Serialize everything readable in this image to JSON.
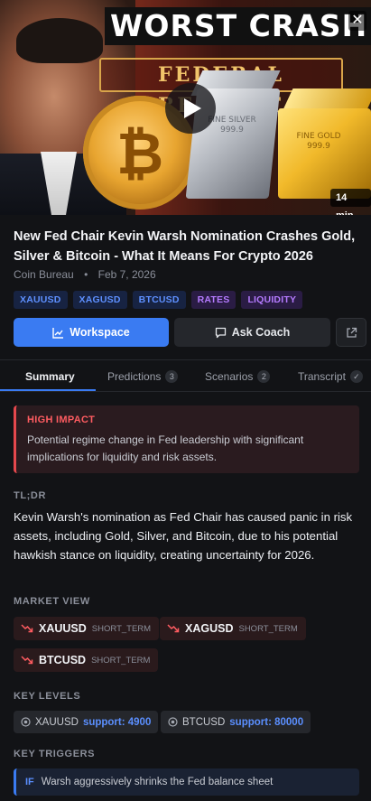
{
  "thumbnail": {
    "overlay_title": "WORST CRASH",
    "banner": "FEDERAL RESERVE",
    "silver_bar_text": "FINE SILVER 999.9",
    "gold_bar_text": "FINE GOLD 999.9",
    "duration": "14 min",
    "close_symbol": "✕"
  },
  "video": {
    "title": "New Fed Chair Kevin Warsh Nomination Crashes Gold, Silver & Bitcoin - What It Means For Crypto 2026",
    "channel": "Coin Bureau",
    "separator": "•",
    "date": "Feb 7, 2026"
  },
  "tags": [
    {
      "label": "XAUUSD",
      "color": "#5e90ff"
    },
    {
      "label": "XAGUSD",
      "color": "#5e90ff"
    },
    {
      "label": "BTCUSD",
      "color": "#5e90ff"
    },
    {
      "label": "RATES",
      "color": "#b57bff"
    },
    {
      "label": "LIQUIDITY",
      "color": "#b57bff"
    }
  ],
  "actions": {
    "workspace_label": "Workspace",
    "coach_label": "Ask Coach"
  },
  "tabs": [
    {
      "label": "Summary",
      "count": ""
    },
    {
      "label": "Predictions",
      "count": "3"
    },
    {
      "label": "Scenarios",
      "count": "2"
    },
    {
      "label": "Transcript",
      "count": "✓"
    }
  ],
  "impact": {
    "label": "HIGH IMPACT",
    "text": "Potential regime change in Fed leadership with significant implications for liquidity and risk assets."
  },
  "tldr": {
    "label": "TL;DR",
    "text": "Kevin Warsh's nomination as Fed Chair has caused panic in risk assets, including Gold, Silver, and Bitcoin, due to his potential hawkish stance on liquidity, creating uncertainty for 2026."
  },
  "market_view": {
    "label": "MARKET VIEW",
    "items": [
      {
        "symbol": "XAUUSD",
        "term": "SHORT_TERM",
        "direction": "down"
      },
      {
        "symbol": "XAGUSD",
        "term": "SHORT_TERM",
        "direction": "down"
      },
      {
        "symbol": "BTCUSD",
        "term": "SHORT_TERM",
        "direction": "down"
      }
    ]
  },
  "key_levels": {
    "label": "KEY LEVELS",
    "items": [
      {
        "symbol": "XAUUSD",
        "level": "support: 4900"
      },
      {
        "symbol": "BTCUSD",
        "level": "support: 80000"
      }
    ]
  },
  "key_triggers": {
    "label": "KEY TRIGGERS",
    "items": [
      {
        "prefix": "IF",
        "text": "Warsh aggressively shrinks the Fed balance sheet"
      }
    ]
  },
  "colors": {
    "accent": "#3a7bf2",
    "danger": "#e5484d",
    "background": "#121316"
  }
}
